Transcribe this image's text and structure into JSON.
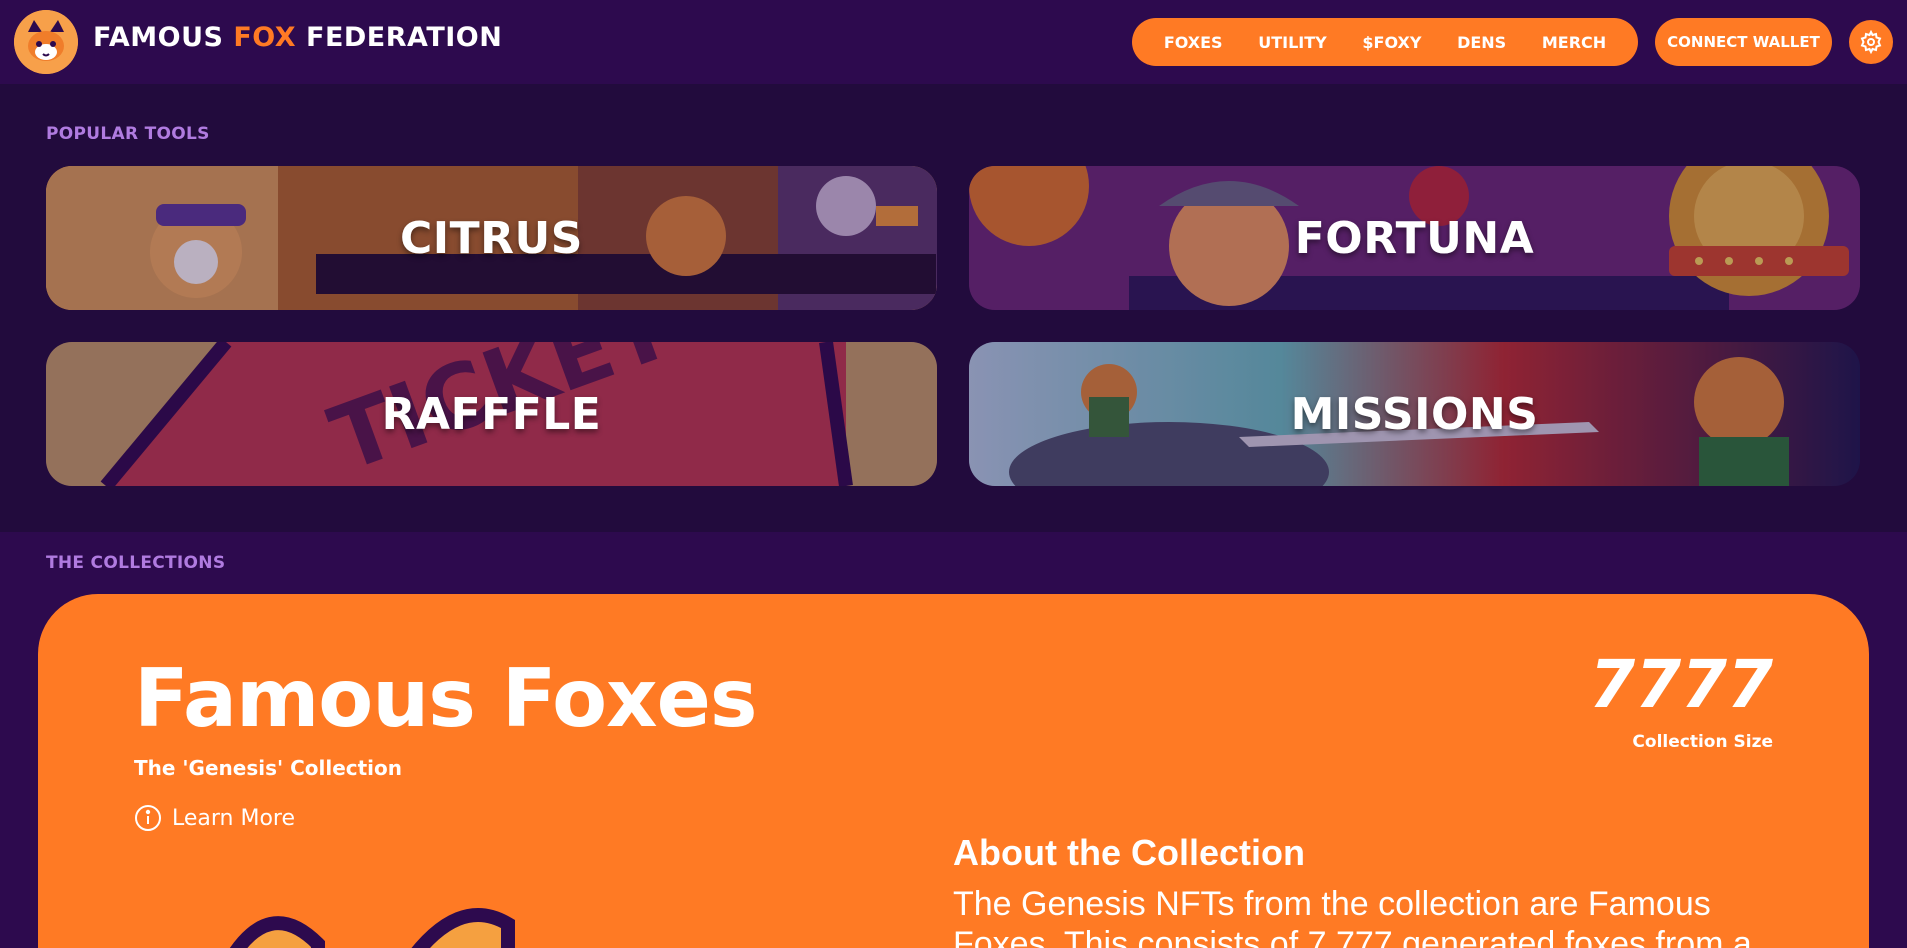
{
  "header": {
    "brand_part1": "FAMOUS ",
    "brand_accent": "FOX",
    "brand_part2": " FEDERATION",
    "nav": [
      "FOXES",
      "UTILITY",
      "$FOXY",
      "DENS",
      "MERCH"
    ],
    "connect_label": "CONNECT WALLET",
    "settings_icon": "gear-icon"
  },
  "tools": {
    "section_label": "POPULAR TOOLS",
    "cards": [
      {
        "label": "CITRUS"
      },
      {
        "label": "FORTUNA"
      },
      {
        "label": "RAFFFLE"
      },
      {
        "label": "MISSIONS"
      }
    ]
  },
  "collections": {
    "section_label": "THE COLLECTIONS",
    "title": "Famous Foxes",
    "subtitle": "The 'Genesis' Collection",
    "learn_more": "Learn More",
    "count": "7777",
    "count_label": "Collection Size",
    "about_title": "About the Collection",
    "about_body": "The Genesis NFTs from the collection are Famous Foxes. This consists of 7,777 generated foxes from a"
  },
  "colors": {
    "background": "#2d0a4e",
    "tools_background": "#220b3d",
    "accent": "#ff7a24",
    "label_purple": "#b07be0"
  }
}
